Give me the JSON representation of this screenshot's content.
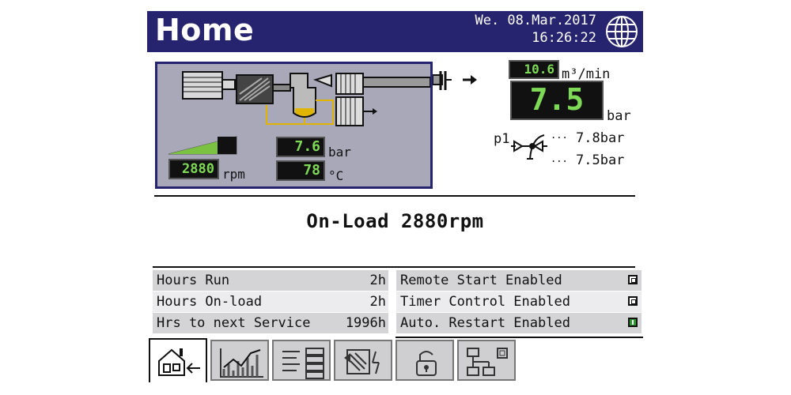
{
  "header": {
    "title": "Home",
    "date": "We. 08.Mar.2017",
    "time": "16:26:22",
    "language_icon": "globe-icon",
    "background_color": "#26246e"
  },
  "process": {
    "speed_value": "2880",
    "speed_unit": "rpm",
    "speed_level_fraction": 0.8,
    "oil_pressure_value": "7.6",
    "oil_pressure_unit": "bar",
    "temperature_value": "78",
    "temperature_unit": "°C"
  },
  "output": {
    "flow_value": "10.6",
    "flow_unit": "m³/min",
    "pressure_value": "7.5",
    "pressure_unit": "bar",
    "p1_label": "p1",
    "p1_upper": "7.8bar",
    "p1_lower": "7.5bar"
  },
  "status_message": "On-Load 2880rpm",
  "info": {
    "left_rows": [
      {
        "label": "Hours Run",
        "value": "2h"
      },
      {
        "label": "Hours On-load",
        "value": "2h"
      },
      {
        "label": "Hrs to next Service",
        "value": "1996h"
      }
    ],
    "right_rows": [
      {
        "label": "Remote Start Enabled",
        "state": "off"
      },
      {
        "label": "Timer Control Enabled",
        "state": "off"
      },
      {
        "label": "Auto. Restart Enabled",
        "state": "on"
      }
    ]
  },
  "tabs": [
    {
      "icon": "home-icon",
      "active": true
    },
    {
      "icon": "trend-chart-icon",
      "active": false
    },
    {
      "icon": "menu-list-icon",
      "active": false
    },
    {
      "icon": "service-icon",
      "active": false
    },
    {
      "icon": "lock-icon",
      "active": false
    },
    {
      "icon": "network-icon",
      "active": false
    }
  ],
  "colors": {
    "lcd_background": "#111111",
    "lcd_text": "#7ed957",
    "panel_background": "#a8a8b8",
    "enabled_green": "#2f9a2f",
    "oil_line": "#e0b400"
  }
}
